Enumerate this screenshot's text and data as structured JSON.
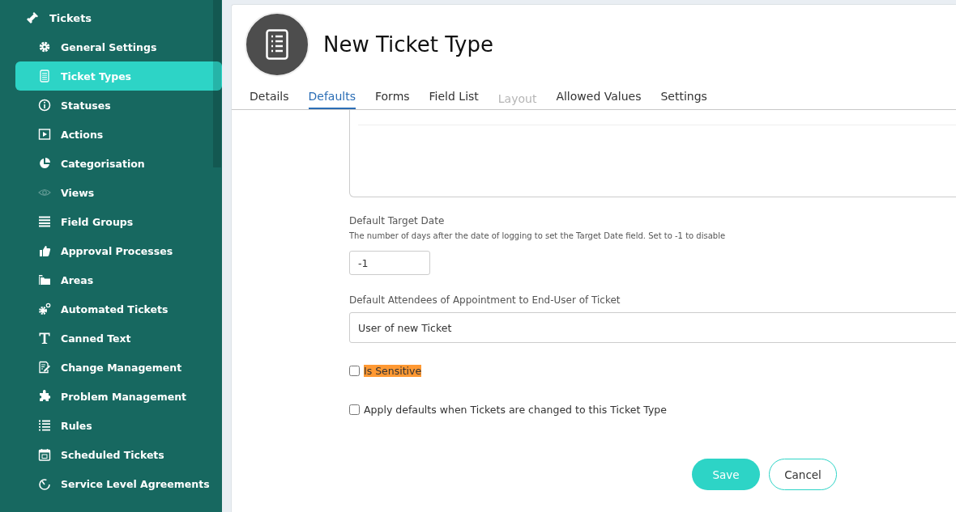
{
  "sidebar": {
    "header": "Tickets",
    "items": [
      {
        "label": "General Settings",
        "selected": false,
        "dimmed": false
      },
      {
        "label": "Ticket Types",
        "selected": true,
        "dimmed": false
      },
      {
        "label": "Statuses",
        "selected": false,
        "dimmed": false
      },
      {
        "label": "Actions",
        "selected": false,
        "dimmed": false
      },
      {
        "label": "Categorisation",
        "selected": false,
        "dimmed": false
      },
      {
        "label": "Views",
        "selected": false,
        "dimmed": true
      },
      {
        "label": "Field Groups",
        "selected": false,
        "dimmed": false
      },
      {
        "label": "Approval Processes",
        "selected": false,
        "dimmed": false
      },
      {
        "label": "Areas",
        "selected": false,
        "dimmed": false
      },
      {
        "label": "Automated Tickets",
        "selected": false,
        "dimmed": false
      },
      {
        "label": "Canned Text",
        "selected": false,
        "dimmed": false
      },
      {
        "label": "Change Management",
        "selected": false,
        "dimmed": false
      },
      {
        "label": "Problem Management",
        "selected": false,
        "dimmed": false
      },
      {
        "label": "Rules",
        "selected": false,
        "dimmed": false
      },
      {
        "label": "Scheduled Tickets",
        "selected": false,
        "dimmed": false
      },
      {
        "label": "Service Level Agreements",
        "selected": false,
        "dimmed": false
      }
    ]
  },
  "page": {
    "title": "New Ticket Type"
  },
  "tabs": [
    {
      "label": "Details",
      "selected": false,
      "disabled": false
    },
    {
      "label": "Defaults",
      "selected": true,
      "disabled": false
    },
    {
      "label": "Forms",
      "selected": false,
      "disabled": false
    },
    {
      "label": "Field List",
      "selected": false,
      "disabled": false
    },
    {
      "label": "Layout",
      "selected": false,
      "disabled": true
    },
    {
      "label": "Allowed Values",
      "selected": false,
      "disabled": false
    },
    {
      "label": "Settings",
      "selected": false,
      "disabled": false
    }
  ],
  "form": {
    "target_date": {
      "label": "Default Target Date",
      "description": "The number of days after the date of logging to set the Target Date field. Set to -1 to disable",
      "value": "-1"
    },
    "attendees": {
      "label": "Default Attendees of Appointment to End-User of Ticket",
      "value": "User of new Ticket"
    },
    "checkboxes": [
      {
        "label": "Is Sensitive",
        "checked": false,
        "highlighted": true
      },
      {
        "label": "Apply defaults when Tickets are changed to this Ticket Type",
        "checked": false,
        "highlighted": false
      }
    ]
  },
  "buttons": [
    {
      "label": "Save",
      "kind": "primary"
    },
    {
      "label": "Cancel",
      "kind": "secondary"
    }
  ]
}
